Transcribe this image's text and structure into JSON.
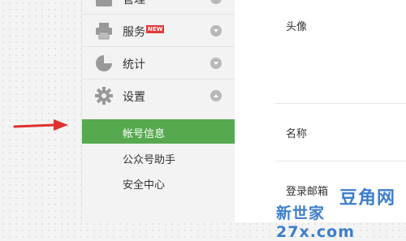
{
  "sidebar": {
    "sections": [
      {
        "label": "管理",
        "icon": "management-icon"
      },
      {
        "label": "服务",
        "badge": "NEW",
        "icon": "printer-icon"
      },
      {
        "label": "统计",
        "icon": "pie-chart-icon"
      },
      {
        "label": "设置",
        "icon": "gear-icon"
      }
    ],
    "sub_items": [
      {
        "label": "帐号信息",
        "active": true
      },
      {
        "label": "公众号助手",
        "active": false
      },
      {
        "label": "安全中心",
        "active": false
      }
    ]
  },
  "content": {
    "fields": [
      "头像",
      "名称",
      "登录邮箱"
    ]
  },
  "watermark": {
    "top": "豆角网",
    "bottom": "新世家 27x.com"
  },
  "colors": {
    "active_green": "#56a94f",
    "arrow_red": "#e03030",
    "watermark_blue": "#3e7ecc"
  }
}
